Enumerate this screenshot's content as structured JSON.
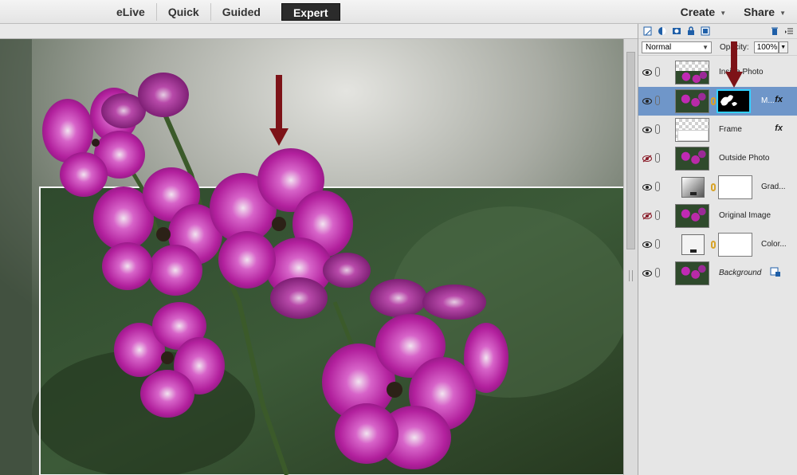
{
  "modes": {
    "elive": "eLive",
    "quick": "Quick",
    "guided": "Guided",
    "expert": "Expert"
  },
  "menus": {
    "create": "Create",
    "share": "Share"
  },
  "layers_panel": {
    "blend_mode": "Normal",
    "opacity_label": "Opacity:",
    "opacity_value": "100%",
    "layers": [
      {
        "name": "Inside Photo",
        "visible": true
      },
      {
        "name": "M...",
        "visible": true,
        "selected": true,
        "fx": "fx"
      },
      {
        "name": "Frame",
        "visible": true,
        "fx": "fx"
      },
      {
        "name": "Outside Photo",
        "visible": false
      },
      {
        "name": "Grad...",
        "visible": true
      },
      {
        "name": "Original Image",
        "visible": false
      },
      {
        "name": "Color...",
        "visible": true
      },
      {
        "name": "Background",
        "visible": true
      }
    ]
  },
  "colors": {
    "selected_layer": "#6f96c9",
    "mask_border": "#33d1ff",
    "annotation_arrow": "#7d1318",
    "petal": "#b4229f"
  }
}
